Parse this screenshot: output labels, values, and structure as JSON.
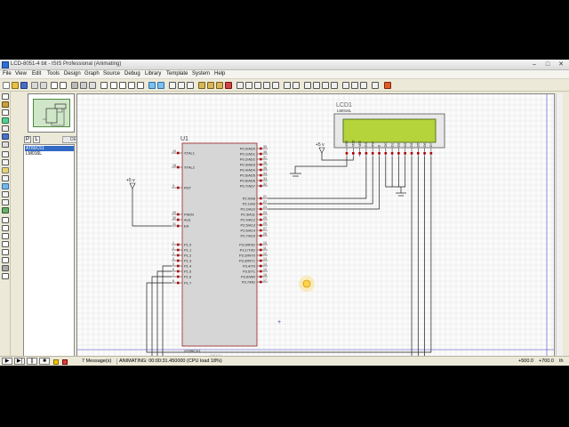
{
  "window": {
    "title": "LCD-8051-4 bit - ISIS Professional (Animating)",
    "minimize": "–",
    "maximize": "□",
    "close": "✕"
  },
  "menu": [
    "File",
    "View",
    "Edit",
    "Tools",
    "Design",
    "Graph",
    "Source",
    "Debug",
    "Library",
    "Template",
    "System",
    "Help"
  ],
  "picker": {
    "p_label": "P",
    "l_label": "L",
    "header": "DEVICES",
    "devices": [
      "AT89C51",
      "LM016L"
    ],
    "selected_index": 0
  },
  "schematic": {
    "mcu": {
      "ref": "U1",
      "part": "AT89C51",
      "hidden_text": "<TEXT>",
      "left_pins": [
        {
          "num": "19",
          "name": "XTAL1"
        },
        {
          "num": "18",
          "name": "XTAL2"
        },
        {
          "num": "9",
          "name": "RST"
        },
        {
          "num": "29",
          "name": "PSEN"
        },
        {
          "num": "30",
          "name": "ALE"
        },
        {
          "num": "31",
          "name": "EA"
        },
        {
          "num": "1",
          "name": "P1.0"
        },
        {
          "num": "2",
          "name": "P1.1"
        },
        {
          "num": "3",
          "name": "P1.2"
        },
        {
          "num": "4",
          "name": "P1.3"
        },
        {
          "num": "5",
          "name": "P1.4"
        },
        {
          "num": "6",
          "name": "P1.5"
        },
        {
          "num": "7",
          "name": "P1.6"
        },
        {
          "num": "8",
          "name": "P1.7"
        }
      ],
      "right_pins": [
        {
          "num": "39",
          "name": "P0.0/AD0"
        },
        {
          "num": "38",
          "name": "P0.1/AD1"
        },
        {
          "num": "37",
          "name": "P0.2/AD2"
        },
        {
          "num": "36",
          "name": "P0.3/AD3"
        },
        {
          "num": "35",
          "name": "P0.4/AD4"
        },
        {
          "num": "34",
          "name": "P0.5/AD5"
        },
        {
          "num": "33",
          "name": "P0.6/AD6"
        },
        {
          "num": "32",
          "name": "P0.7/AD7"
        },
        {
          "num": "21",
          "name": "P2.0/A8"
        },
        {
          "num": "22",
          "name": "P2.1/A9"
        },
        {
          "num": "23",
          "name": "P2.2/A10"
        },
        {
          "num": "24",
          "name": "P2.3/A11"
        },
        {
          "num": "25",
          "name": "P2.4/A12"
        },
        {
          "num": "26",
          "name": "P2.5/A13"
        },
        {
          "num": "27",
          "name": "P2.6/A14"
        },
        {
          "num": "28",
          "name": "P2.7/A15"
        },
        {
          "num": "10",
          "name": "P3.0/RXD"
        },
        {
          "num": "11",
          "name": "P3.1/TXD"
        },
        {
          "num": "12",
          "name": "P3.2/INT0"
        },
        {
          "num": "13",
          "name": "P3.3/INT1"
        },
        {
          "num": "14",
          "name": "P3.4/T0"
        },
        {
          "num": "15",
          "name": "P3.5/T1"
        },
        {
          "num": "16",
          "name": "P3.6/WR"
        },
        {
          "num": "17",
          "name": "P3.7/RD"
        }
      ]
    },
    "lcd": {
      "ref": "LCD1",
      "part": "LM016L",
      "pins": [
        "VSS",
        "VDD",
        "VEE",
        "RS",
        "RW",
        "E",
        "D0",
        "D1",
        "D2",
        "D3",
        "D4",
        "D5",
        "D6",
        "D7"
      ],
      "screen_color": "#b5d43c"
    },
    "power_label": "+5 v"
  },
  "status": {
    "messages": "7 Message(s)",
    "animating": "ANIMATING: 00:00:31.450000 (CPU load 18%)",
    "coord_x": "+500.0",
    "coord_y": "+700.0",
    "unit": "th"
  },
  "colors": {
    "grid": "#dedede",
    "wire": "#1c1c1c",
    "pin": "#b00000",
    "chip_fill": "#d6d6d6",
    "chip_border": "#9b2020",
    "cursor_glow": "#ffd34d"
  }
}
